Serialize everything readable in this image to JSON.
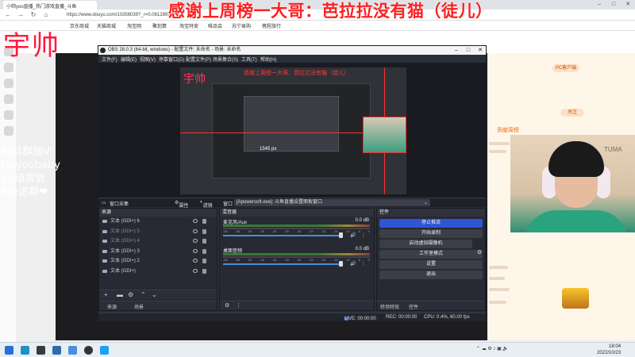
{
  "browser": {
    "tab_title": "小帅yoo直播_热门游戏直播_斗鱼",
    "url": "https://www.douyu.com/10356039?_r=0.06128979",
    "bookmarks": [
      "京东商城",
      "天猫商城",
      "淘宝网",
      "聚划算",
      "淘宝特卖",
      "唯品会",
      "苏宁易购",
      "携程旅行"
    ]
  },
  "overlay": {
    "top_banner": "感谢上周榜一大哥：芭拉拉没有猫（徒儿）",
    "streamer_tag": "宇帅",
    "fan_group": {
      "line1": "粉丝群加V:",
      "line2": "ttoyoobaby",
      "line3": "16级房管",
      "line4": "8级进群❤"
    },
    "webcam_brand": "TUMA"
  },
  "douyu": {
    "left_number": "12",
    "right_panel_title": "贡献周榜",
    "right_btn_1": "PC客户端",
    "right_btn_2": "关注"
  },
  "obs": {
    "title": "OBS 28.0.3 (64-bit, windows) - 配置文件: 未命名 - 场景: 未命名",
    "menu": [
      "文件(F)",
      "编辑(E)",
      "视图(V)",
      "停靠窗口(D)",
      "配置文件(P)",
      "场景集合(S)",
      "工具(T)",
      "帮助(H)"
    ],
    "preview_text": "感谢上周榜一大哥：芭拉拉没有猫（徒儿）",
    "preview_yu": "宇帅",
    "preview_number": "1545 px",
    "source_bar": {
      "source_name": "窗口采集",
      "properties": "属性",
      "filters": "滤镜",
      "window_label": "窗口",
      "window_value": "[Apowersoft.exe]: 斗鱼直播设置面板窗口"
    },
    "sources_dock": {
      "title": "来源",
      "items": [
        {
          "name": "文本 (GDI+) 6",
          "dim": false
        },
        {
          "name": "文本 (GDI+) 5",
          "dim": true
        },
        {
          "name": "文本 (GDI+) 4",
          "dim": true
        },
        {
          "name": "文本 (GDI+) 3",
          "dim": false
        },
        {
          "name": "文本 (GDI+) 2",
          "dim": false
        },
        {
          "name": "文本 (GDI+)",
          "dim": false
        }
      ],
      "tab_sources": "来源",
      "tab_scenes": "场景"
    },
    "mixer_dock": {
      "title": "混音器",
      "channels": [
        {
          "name": "麦克风/Aux",
          "db": "0.0 dB"
        },
        {
          "name": "桌面音频",
          "db": "0.0 dB"
        }
      ],
      "ticks": [
        "-60",
        "-55",
        "-50",
        "-45",
        "-40",
        "-35",
        "-30",
        "-25",
        "-20",
        "-15",
        "-10",
        "-5",
        "0"
      ]
    },
    "controls_dock": {
      "title": "控件",
      "buttons": [
        "停止推流",
        "开始录制",
        "启动虚拟摄像机",
        "工作室模式",
        "设置",
        "退出"
      ],
      "tab_transitions": "转场特效",
      "tab_controls": "控件"
    },
    "status": {
      "live": "LIVE: 00:00:00",
      "rec": "REC: 00:00:00",
      "cpu": "CPU: 0.4%, 60.00 fps"
    }
  },
  "taskbar": {
    "time": "18:04",
    "date": "2022/10/23"
  }
}
